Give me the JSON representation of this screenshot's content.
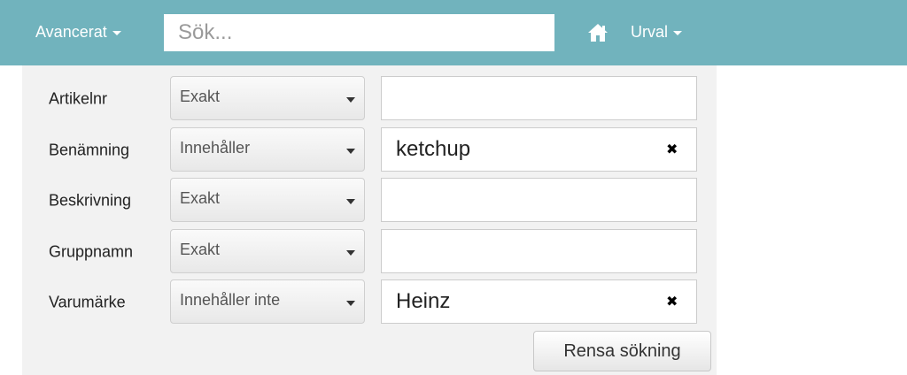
{
  "navbar": {
    "advanced_label": "Avancerat",
    "search_placeholder": "Sök...",
    "search_value": "",
    "selection_label": "Urval",
    "home_icon": "home-icon"
  },
  "filters": [
    {
      "label": "Artikelnr",
      "operator": "Exakt",
      "value": ""
    },
    {
      "label": "Benämning",
      "operator": "Innehåller",
      "value": "ketchup",
      "clear_glyph": "✖"
    },
    {
      "label": "Beskrivning",
      "operator": "Exakt",
      "value": ""
    },
    {
      "label": "Gruppnamn",
      "operator": "Exakt",
      "value": ""
    },
    {
      "label": "Varumärke",
      "operator": "Innehåller inte",
      "value": "Heinz",
      "clear_glyph": "✖"
    }
  ],
  "reset_label": "Rensa sökning"
}
